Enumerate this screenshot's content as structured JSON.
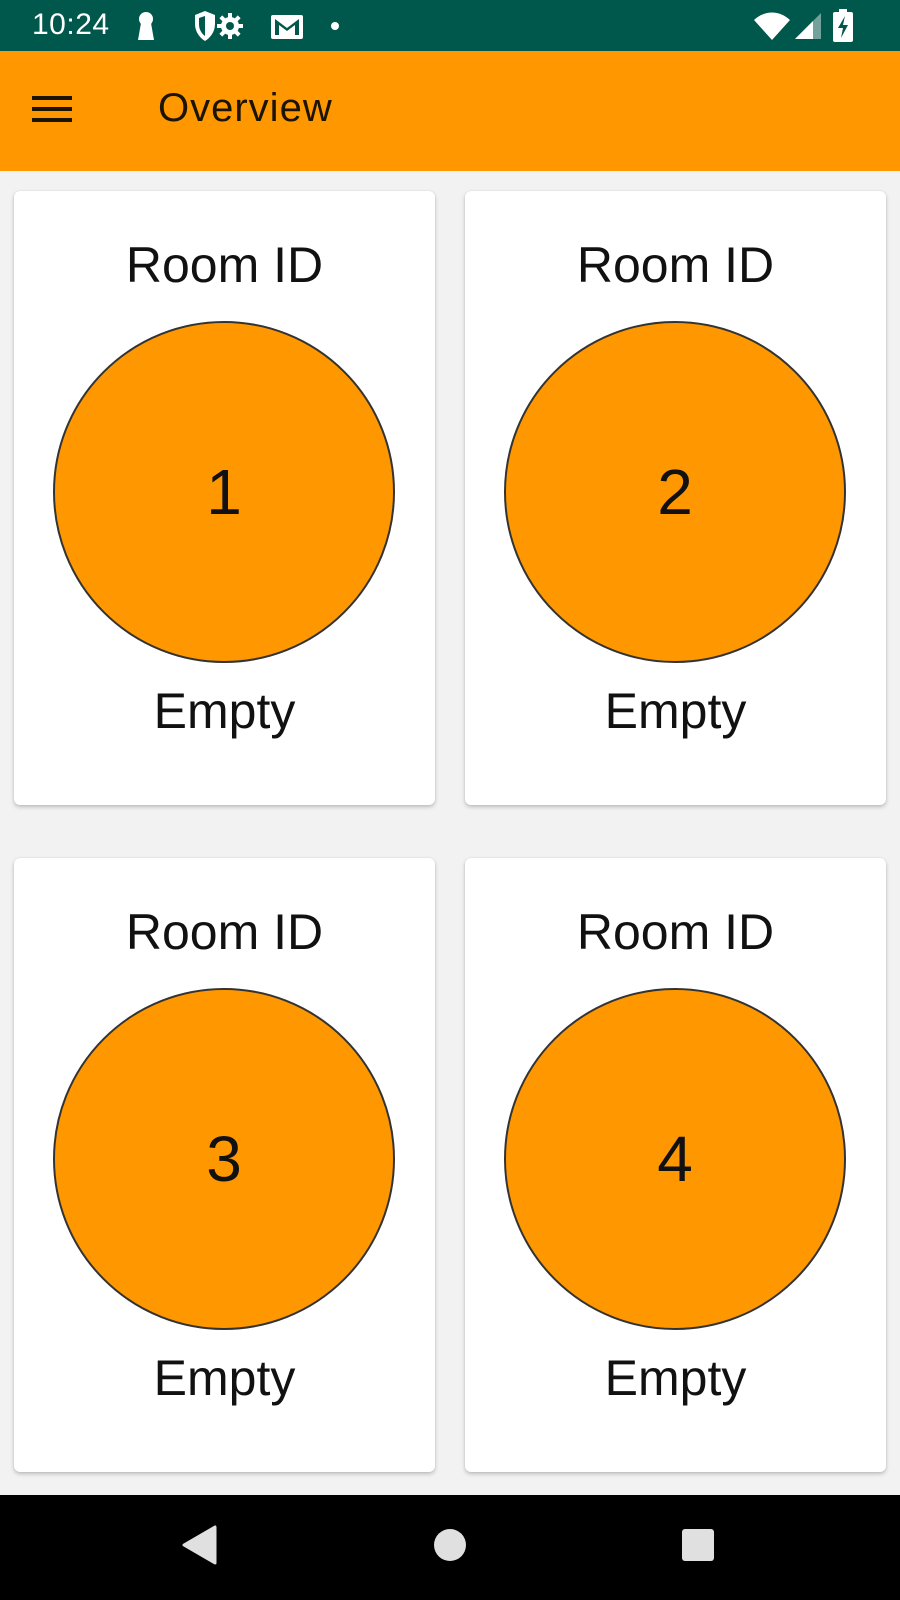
{
  "status_bar": {
    "time": "10:24",
    "icons_left": [
      "keyhole-icon",
      "shield-gear-icon",
      "gmail-icon",
      "notification-dot-icon"
    ],
    "icons_right": [
      "wifi-icon",
      "signal-icon",
      "battery-charging-icon"
    ]
  },
  "app_bar": {
    "title": "Overview",
    "menu_icon": "hamburger-menu-icon",
    "background": "#ff9800"
  },
  "rooms": [
    {
      "title": "Room ID",
      "number": "1",
      "status": "Empty"
    },
    {
      "title": "Room ID",
      "number": "2",
      "status": "Empty"
    },
    {
      "title": "Room ID",
      "number": "3",
      "status": "Empty"
    },
    {
      "title": "Room ID",
      "number": "4",
      "status": "Empty"
    }
  ],
  "colors": {
    "status_bar": "#00574b",
    "accent": "#ff9800",
    "card": "#ffffff",
    "nav_bar": "#000000"
  },
  "nav_bar": {
    "buttons": [
      "back-icon",
      "home-icon",
      "recents-icon"
    ]
  }
}
